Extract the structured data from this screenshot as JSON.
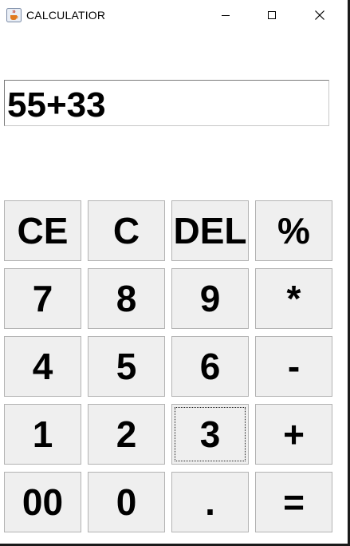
{
  "window": {
    "title": "CALCULATIOR",
    "icon": "java-cup-icon",
    "controls": [
      "minimize",
      "maximize",
      "close"
    ]
  },
  "display": {
    "value": "55+33"
  },
  "keypad": {
    "rows": [
      [
        "CE",
        "C",
        "DEL",
        "%"
      ],
      [
        "7",
        "8",
        "9",
        "*"
      ],
      [
        "4",
        "5",
        "6",
        "-"
      ],
      [
        "1",
        "2",
        "3",
        "+"
      ],
      [
        "00",
        "0",
        ".",
        "="
      ]
    ],
    "focused_key": "3"
  },
  "colors": {
    "button_bg": "#efefef",
    "button_border": "#b3b3b3",
    "window_border": "#1a1a1a"
  }
}
